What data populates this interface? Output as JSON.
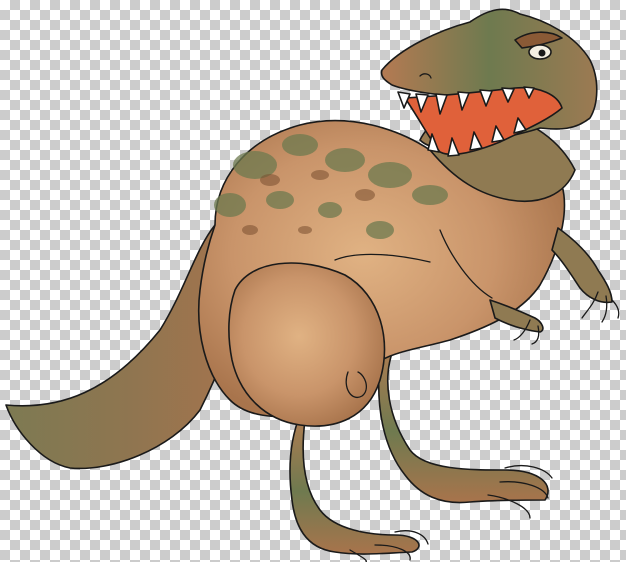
{
  "image": {
    "subject": "cartoon-tyrannosaurus",
    "background": "transparency-checkerboard",
    "colors": {
      "checker_light": "#ffffff",
      "checker_dark": "#cccccc",
      "body_brown": "#a8744c",
      "belly_tan": "#d7a677",
      "camo_green": "#6e7a4f",
      "mouth_red": "#e0613a",
      "outline": "#1a1a1a",
      "teeth": "#ffffff"
    }
  }
}
